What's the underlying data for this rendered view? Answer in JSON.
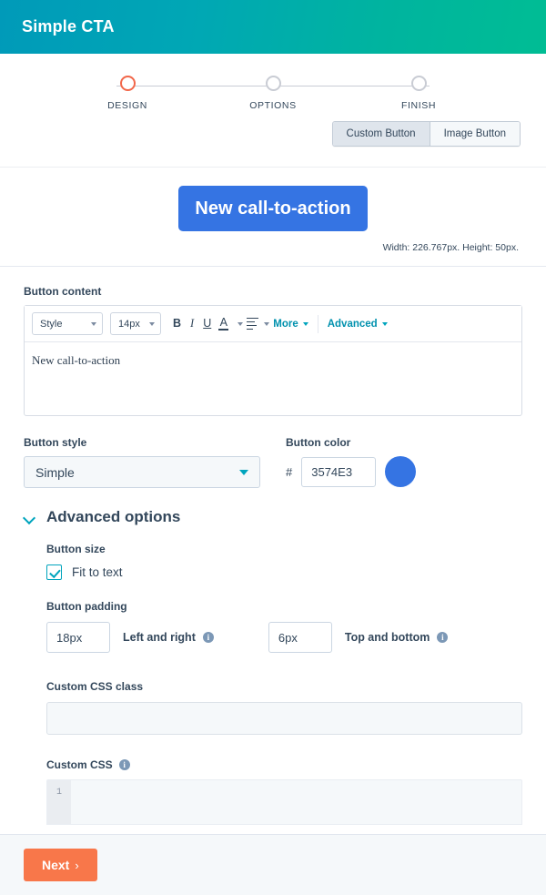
{
  "header": {
    "title": "Simple CTA",
    "gradient_from": "#009ab9",
    "gradient_to": "#00bd94"
  },
  "stepper": {
    "active_index": 0,
    "active_color": "#f2674a",
    "inactive_color": "#c9ccd4",
    "steps": [
      {
        "label": "DESIGN"
      },
      {
        "label": "OPTIONS"
      },
      {
        "label": "FINISH"
      }
    ]
  },
  "type_toggle": {
    "options": [
      {
        "label": "Custom Button",
        "active": true
      },
      {
        "label": "Image Button",
        "active": false
      }
    ]
  },
  "preview": {
    "cta_text": "New call-to-action",
    "cta_color": "#3574E3",
    "dimensions": "Width: 226.767px. Height: 50px."
  },
  "button_content": {
    "label": "Button content",
    "toolbar": {
      "style_select": "Style",
      "size_select": "14px",
      "bold": "B",
      "italic": "I",
      "underline": "U",
      "font_color": "A",
      "more": "More",
      "advanced": "Advanced",
      "link_color": "#0091ae"
    },
    "editor_text": "New call-to-action"
  },
  "button_style": {
    "label": "Button style",
    "value": "Simple"
  },
  "button_color": {
    "label": "Button color",
    "hash": "#",
    "value": "3574E3",
    "swatch": "#3574E3"
  },
  "advanced_options": {
    "title": "Advanced options",
    "expanded": true,
    "button_size": {
      "label": "Button size",
      "fit_to_text_label": "Fit to text",
      "fit_to_text_checked": true
    },
    "button_padding": {
      "label": "Button padding",
      "left_right": {
        "value": "18px",
        "label": "Left and right"
      },
      "top_bottom": {
        "value": "6px",
        "label": "Top and bottom"
      }
    },
    "custom_css_class": {
      "label": "Custom CSS class",
      "value": "",
      "placeholder": ""
    },
    "custom_css": {
      "label": "Custom CSS",
      "line_number": "1",
      "value": ""
    }
  },
  "footer": {
    "next_label": "Next",
    "next_chevron": "›",
    "next_color": "#f8774a"
  }
}
